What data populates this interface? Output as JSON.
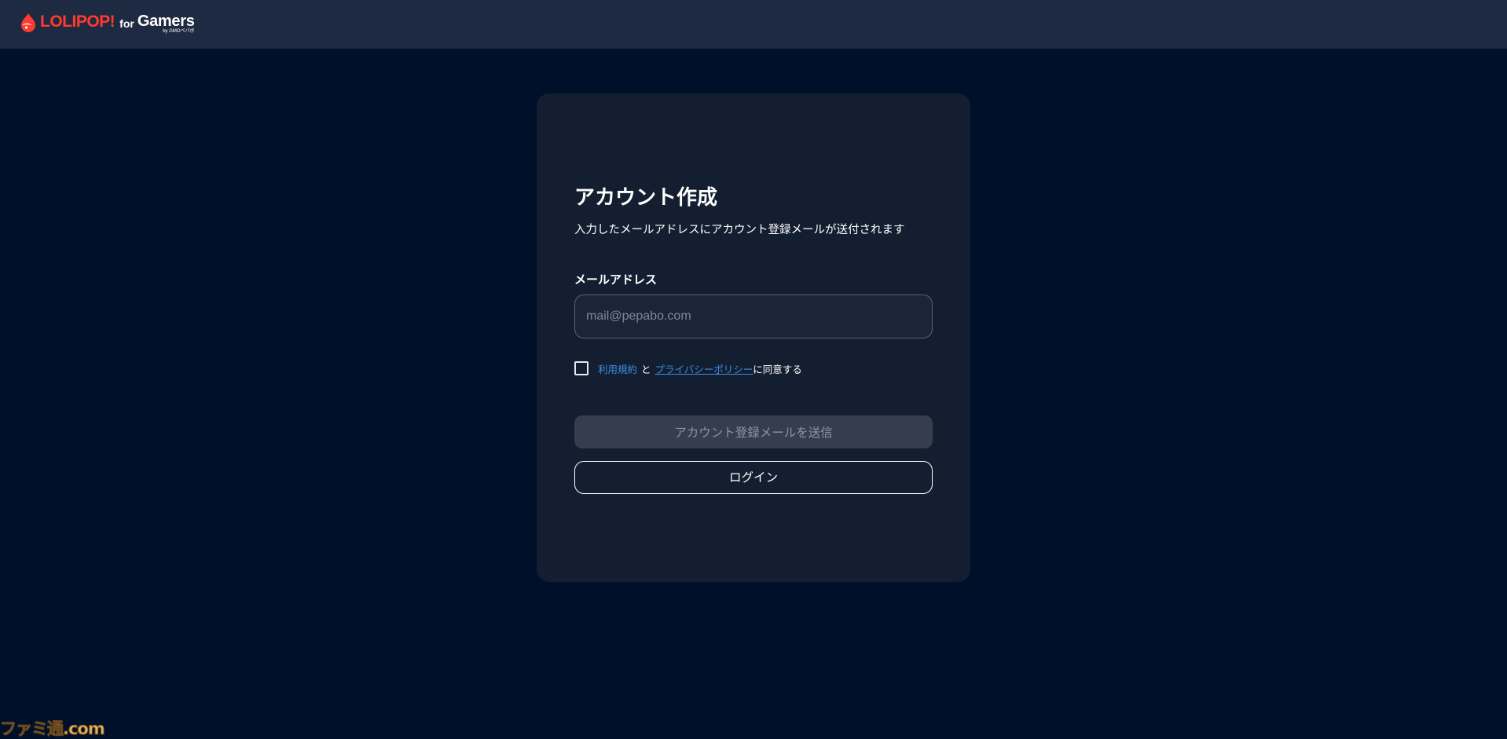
{
  "header": {
    "logo": {
      "brand": "LOLIPOP!",
      "for": "for",
      "product": "Gamers",
      "by": "by GMOペパボ",
      "icon": "lolipop-drop-icon",
      "brand_color": "#ff3b30"
    }
  },
  "form": {
    "title": "アカウント作成",
    "subtitle": "入力したメールアドレスにアカウント登録メールが送付されます",
    "email_label": "メールアドレス",
    "email_value": "",
    "email_placeholder": "mail@pepabo.com",
    "agreement": {
      "checked": false,
      "terms_link": "利用規約",
      "connector": "と",
      "privacy_link": "プライバシーポリシー",
      "suffix": "に同意する"
    },
    "submit_label": "アカウント登録メールを送信",
    "login_label": "ログイン"
  },
  "watermark": "ファミ通.com",
  "colors": {
    "background": "#00102b",
    "header": "#1e2a41",
    "card": "#131e31",
    "link": "#3d8fe6",
    "disabled_button": "#363e4e"
  }
}
